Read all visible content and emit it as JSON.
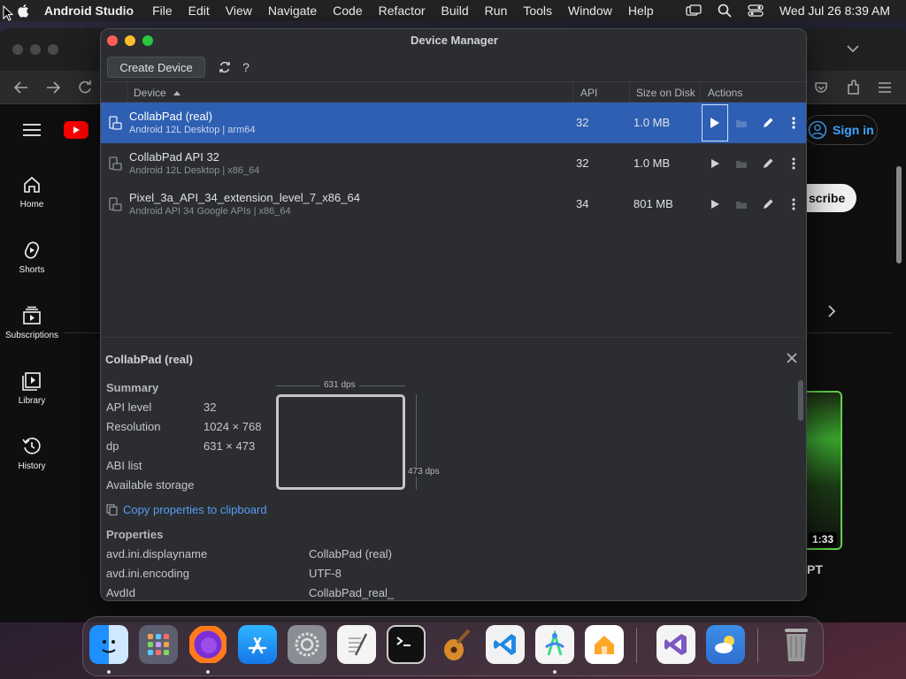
{
  "menubar": {
    "app_name": "Android Studio",
    "items": [
      "File",
      "Edit",
      "View",
      "Navigate",
      "Code",
      "Refactor",
      "Build",
      "Run",
      "Tools",
      "Window",
      "Help"
    ],
    "clock": "Wed Jul 26  8:39 AM"
  },
  "browser": {
    "sidebar": [
      {
        "label": "Home",
        "icon": "home-icon"
      },
      {
        "label": "Shorts",
        "icon": "shorts-icon"
      },
      {
        "label": "Subscriptions",
        "icon": "subscriptions-icon"
      },
      {
        "label": "Library",
        "icon": "library-icon"
      },
      {
        "label": "History",
        "icon": "history-icon"
      }
    ],
    "sign_in": "Sign in",
    "subscribe_fragment": "scribe",
    "video_duration": "1:33",
    "video_title_fragment": "PT"
  },
  "device_manager": {
    "title": "Device Manager",
    "create_button": "Create Device",
    "columns": {
      "device": "Device",
      "api": "API",
      "size": "Size on Disk",
      "actions": "Actions"
    },
    "devices": [
      {
        "name": "CollabPad (real)",
        "details": "Android 12L Desktop | arm64",
        "api": "32",
        "size": "1.0 MB",
        "selected": true
      },
      {
        "name": "CollabPad API 32",
        "details": "Android 12L Desktop | x86_64",
        "api": "32",
        "size": "1.0 MB",
        "selected": false
      },
      {
        "name": "Pixel_3a_API_34_extension_level_7_x86_64",
        "details": "Android API 34 Google APIs | x86_64",
        "api": "34",
        "size": "801 MB",
        "selected": false
      }
    ],
    "details": {
      "title": "CollabPad (real)",
      "summary_heading": "Summary",
      "summary": [
        {
          "key": "API level",
          "value": "32"
        },
        {
          "key": "Resolution",
          "value": "1024 × 768"
        },
        {
          "key": "dp",
          "value": "631 × 473"
        },
        {
          "key": "ABI list",
          "value": ""
        },
        {
          "key": "Available storage",
          "value": ""
        }
      ],
      "width_label": "631 dps",
      "height_label": "473 dps",
      "copy_link": "Copy properties to clipboard",
      "properties_heading": "Properties",
      "properties": [
        {
          "key": "avd.ini.displayname",
          "value": "CollabPad (real)"
        },
        {
          "key": "avd.ini.encoding",
          "value": "UTF-8"
        },
        {
          "key": "AvdId",
          "value": "CollabPad_real_"
        }
      ]
    }
  },
  "dock": {
    "apps": [
      "Finder",
      "Launchpad",
      "Firefox",
      "App Store",
      "System Settings",
      "TextEdit",
      "Terminal",
      "GarageBand",
      "Visual Studio Code",
      "Android Studio",
      "Home",
      "Visual Studio",
      "Weather",
      "Trash"
    ]
  }
}
